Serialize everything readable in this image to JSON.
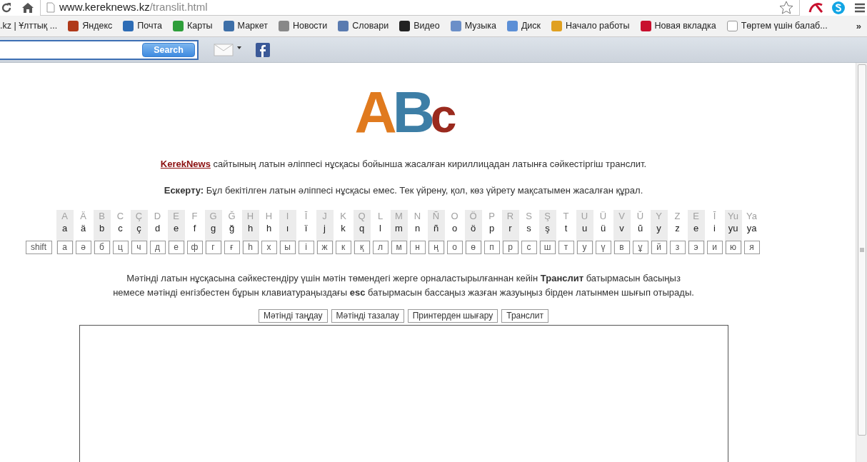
{
  "browser": {
    "url_host": "www.kereknews.kz",
    "url_path": "/translit.html"
  },
  "bookmarks": [
    ".kz | Ұлттық ...",
    "Яндекс",
    "Почта",
    "Карты",
    "Маркет",
    "Новости",
    "Словари",
    "Видео",
    "Музыка",
    "Диск",
    "Начало работы",
    "Новая вкладка",
    "Төртем үшін балаб..."
  ],
  "bookmarks_more": "»",
  "toolbar": {
    "search_button": "Search"
  },
  "logo": [
    "A",
    "B",
    "c"
  ],
  "intro": {
    "link": "KerekNews",
    "text": " сайтының латын әліппесі нұсқасы бойынша жасалған кириллицадан латынға сәйкестіргіш транслит."
  },
  "note": "**Ескерту:** Бұл бекітілген латын әліппесі нұсқасы емес. Тек үйрену, қол, көз үйрету мақсатымен жасалған құрал.",
  "shift_key": "shift",
  "letters": [
    {
      "upper": "A",
      "lower": "a",
      "key": "а"
    },
    {
      "upper": "Ä",
      "lower": "ä",
      "key": "ә"
    },
    {
      "upper": "B",
      "lower": "b",
      "key": "б"
    },
    {
      "upper": "C",
      "lower": "c",
      "key": "ц"
    },
    {
      "upper": "Ç",
      "lower": "ç",
      "key": "ч"
    },
    {
      "upper": "D",
      "lower": "d",
      "key": "д"
    },
    {
      "upper": "E",
      "lower": "e",
      "key": "е"
    },
    {
      "upper": "F",
      "lower": "f",
      "key": "ф"
    },
    {
      "upper": "G",
      "lower": "g",
      "key": "г"
    },
    {
      "upper": "Ğ",
      "lower": "ğ",
      "key": "ғ"
    },
    {
      "upper": "H",
      "lower": "h",
      "key": "һ"
    },
    {
      "upper": "H",
      "lower": "h",
      "key": "х"
    },
    {
      "upper": "I",
      "lower": "ı",
      "key": "ы"
    },
    {
      "upper": "Ī",
      "lower": "ï",
      "key": "і"
    },
    {
      "upper": "J",
      "lower": "j",
      "key": "ж"
    },
    {
      "upper": "K",
      "lower": "k",
      "key": "к"
    },
    {
      "upper": "Q",
      "lower": "q",
      "key": "қ"
    },
    {
      "upper": "L",
      "lower": "l",
      "key": "л"
    },
    {
      "upper": "M",
      "lower": "m",
      "key": "м"
    },
    {
      "upper": "N",
      "lower": "n",
      "key": "н"
    },
    {
      "upper": "Ñ",
      "lower": "ñ",
      "key": "ң"
    },
    {
      "upper": "O",
      "lower": "o",
      "key": "о"
    },
    {
      "upper": "Ö",
      "lower": "ö",
      "key": "ө"
    },
    {
      "upper": "P",
      "lower": "p",
      "key": "п"
    },
    {
      "upper": "R",
      "lower": "r",
      "key": "р"
    },
    {
      "upper": "S",
      "lower": "s",
      "key": "с"
    },
    {
      "upper": "Ş",
      "lower": "ş",
      "key": "ш"
    },
    {
      "upper": "T",
      "lower": "t",
      "key": "т"
    },
    {
      "upper": "U",
      "lower": "u",
      "key": "у"
    },
    {
      "upper": "Ü",
      "lower": "ü",
      "key": "ү"
    },
    {
      "upper": "V",
      "lower": "v",
      "key": "в"
    },
    {
      "upper": "Ŭ",
      "lower": "ŭ",
      "key": "ұ"
    },
    {
      "upper": "Y",
      "lower": "y",
      "key": "й"
    },
    {
      "upper": "Z",
      "lower": "z",
      "key": "з"
    },
    {
      "upper": "E",
      "lower": "e",
      "key": "э"
    },
    {
      "upper": "Ī",
      "lower": "i",
      "key": "и"
    },
    {
      "upper": "Yu",
      "lower": "yu",
      "key": "ю"
    },
    {
      "upper": "Ya",
      "lower": "ya",
      "key": "я"
    }
  ],
  "instruction_lines": [
    "Мәтінді латын нұсқасына сәйкестендіру үшін мәтін төмендегі жерге орналастырылғаннан кейін **Транслит** батырмасын басыңыз",
    "немесе мәтінді енгізбестен бұрын клавиатураңыздағы **esc** батырмасын бассаңыз жазған жазуыңыз бірден латынмен шығып отырады."
  ],
  "buttons": [
    "Мәтінді таңдау",
    "Мәтінді тазалау",
    "Принтерден шығару",
    "Транслит"
  ]
}
